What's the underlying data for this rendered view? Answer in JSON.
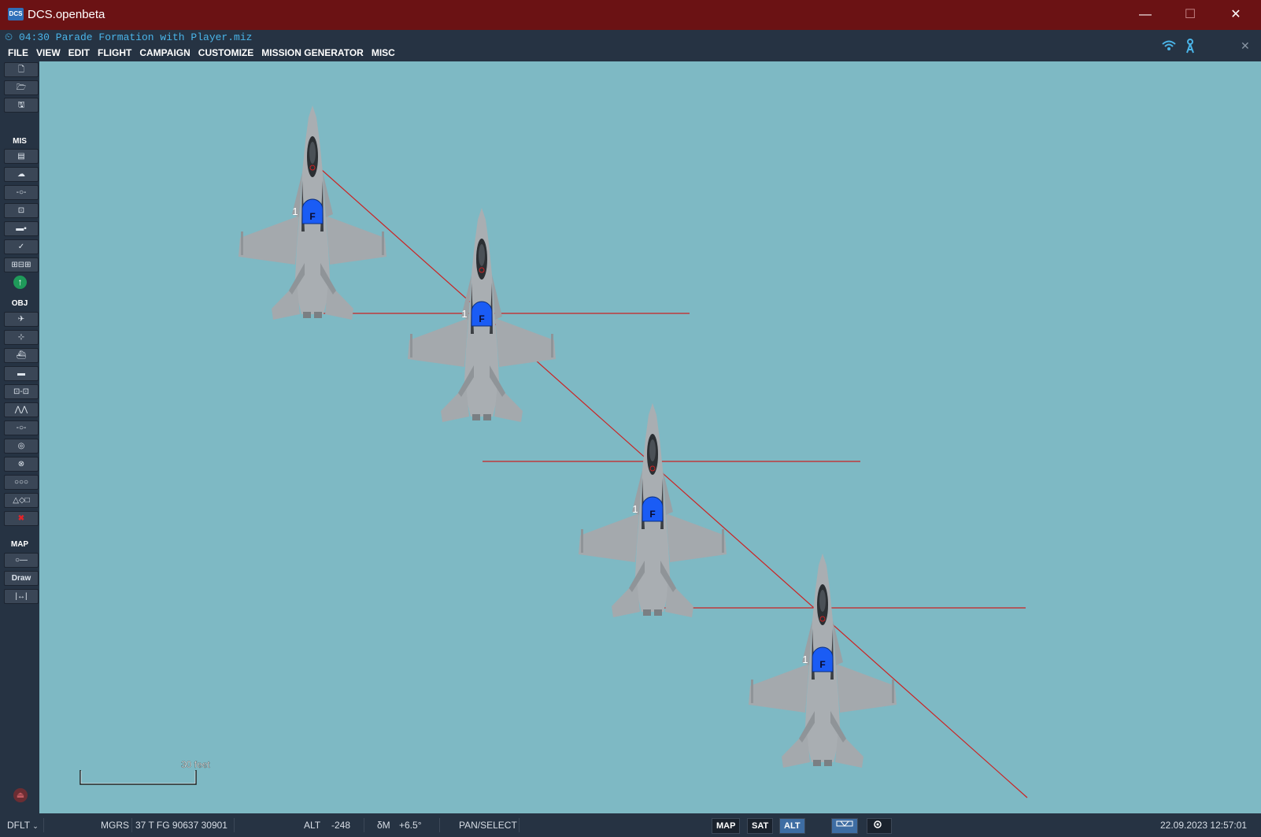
{
  "window": {
    "title": "DCS.openbeta",
    "logo_text": "DCS",
    "minimize": "—",
    "maximize": "☐",
    "close": "✕"
  },
  "mission": {
    "time": "04:30",
    "name": "Parade Formation with Player.miz"
  },
  "menu": [
    "FILE",
    "VIEW",
    "EDIT",
    "FLIGHT",
    "CAMPAIGN",
    "CUSTOMIZE",
    "MISSION GENERATOR",
    "MISC"
  ],
  "toolbar": {
    "file_buttons": [
      "🗋",
      "🗁",
      "🖫"
    ],
    "mis_label": "MIS",
    "mis_buttons": [
      "▤",
      "☁",
      "-○-",
      "⊡",
      "▬▪",
      "✓",
      "⊞⊟⊞"
    ],
    "obj_label": "OBJ",
    "obj_buttons": [
      "✈",
      "⊹",
      "⛴",
      "▬",
      "⊡-⊡",
      "⋀⋀",
      "-○-",
      "◎",
      "⊗",
      "○○○",
      "△◇□",
      "✖"
    ],
    "map_label": "MAP",
    "map_buttons": [
      "○—",
      "Draw",
      "|↔|"
    ]
  },
  "map": {
    "scale_label": "30 feet",
    "units": [
      {
        "label": "F",
        "number": "1"
      },
      {
        "label": "F",
        "number": "1"
      },
      {
        "label": "F",
        "number": "1"
      },
      {
        "label": "F",
        "number": "1"
      }
    ],
    "colors": {
      "background": "#7eb9c4",
      "line": "#cc2222",
      "unit_marker": "#1a5cf5",
      "aircraft": "#a9aeb2"
    }
  },
  "status": {
    "profile": "DFLT",
    "coord_system": "MGRS",
    "coords": "37 T FG 90637 30901",
    "alt_label": "ALT",
    "alt_value": "-248",
    "magvar_label": "δM",
    "magvar_value": "+6.5°",
    "mode": "PAN/SELECT",
    "map_buttons": [
      "MAP",
      "SAT",
      "ALT"
    ],
    "active_map_button": "ALT",
    "datetime": "22.09.2023 12:57:01"
  }
}
